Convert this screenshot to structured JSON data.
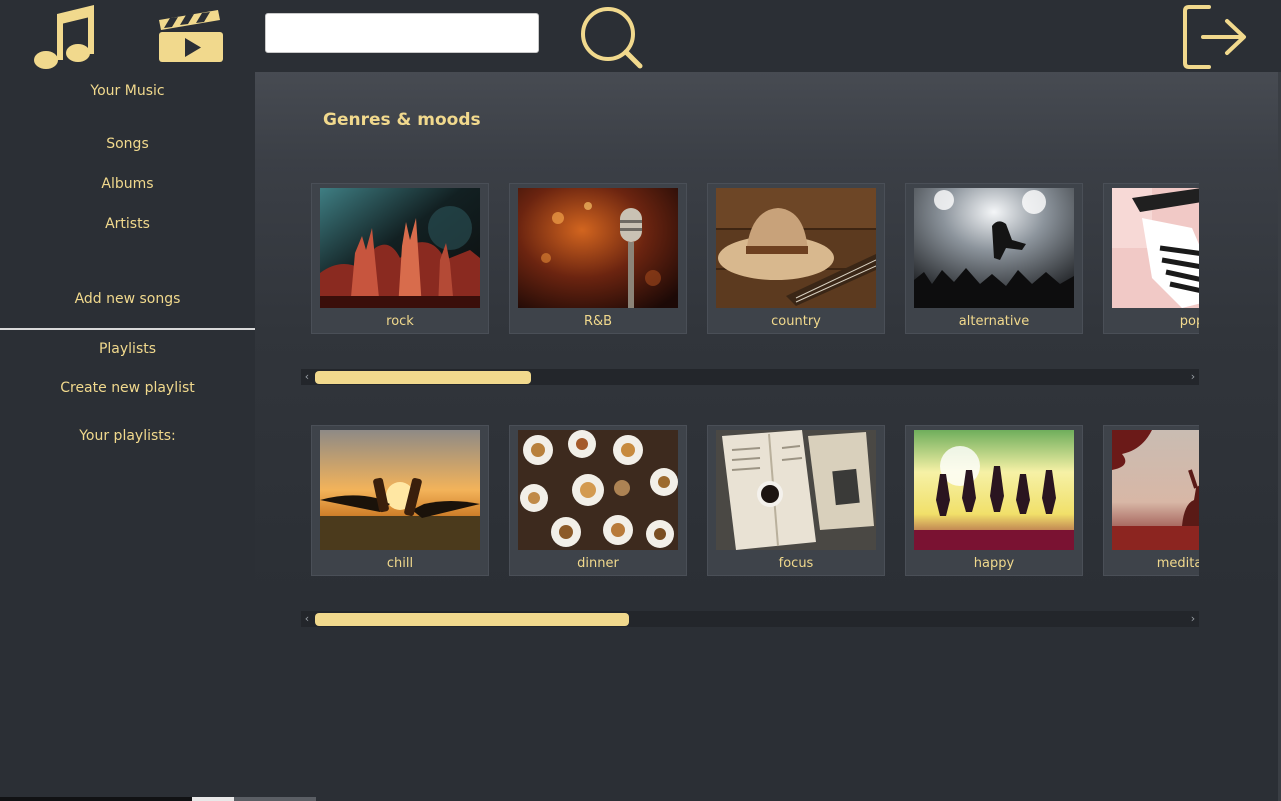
{
  "header": {
    "search": {
      "value": "",
      "placeholder": ""
    }
  },
  "sidebar": {
    "your_music": "Your Music",
    "songs": "Songs",
    "albums": "Albums",
    "artists": "Artists",
    "add_new_songs": "Add new songs",
    "playlists": "Playlists",
    "create_new_playlist": "Create new playlist",
    "your_playlists": "Your playlists:"
  },
  "main": {
    "title": "Genres & moods",
    "genres": [
      {
        "label": "rock"
      },
      {
        "label": "R&B"
      },
      {
        "label": "country"
      },
      {
        "label": "alternative"
      },
      {
        "label": "pop"
      }
    ],
    "moods": [
      {
        "label": "chill"
      },
      {
        "label": "dinner"
      },
      {
        "label": "focus"
      },
      {
        "label": "happy"
      },
      {
        "label": "meditation"
      }
    ]
  },
  "colors": {
    "accent": "#f1d98d",
    "background": "#2b2f35",
    "panel": "#3e434a"
  },
  "icons": {
    "music": "music-note-icon",
    "video": "clapperboard-icon",
    "search": "search-icon",
    "logout": "logout-icon"
  }
}
